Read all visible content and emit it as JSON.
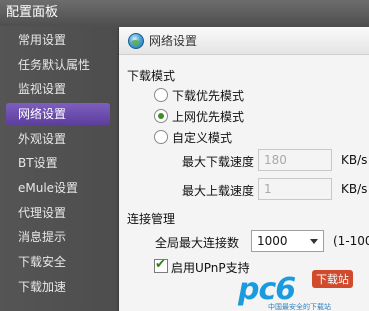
{
  "window": {
    "title": "配置面板"
  },
  "sidebar": {
    "items": [
      {
        "label": "常用设置",
        "active": false
      },
      {
        "label": "任务默认属性",
        "active": false
      },
      {
        "label": "监视设置",
        "active": false
      },
      {
        "label": "网络设置",
        "active": true
      },
      {
        "label": "外观设置",
        "active": false
      },
      {
        "label": "BT设置",
        "active": false
      },
      {
        "label": "eMule设置",
        "active": false
      },
      {
        "label": "代理设置",
        "active": false
      },
      {
        "label": "消息提示",
        "active": false
      },
      {
        "label": "下载安全",
        "active": false
      },
      {
        "label": "下载加速",
        "active": false
      }
    ]
  },
  "panel": {
    "header": {
      "title": "网络设置",
      "icon": "globe-icon"
    },
    "download_mode": {
      "title": "下载模式",
      "options": [
        {
          "label": "下载优先模式",
          "checked": false
        },
        {
          "label": "上网优先模式",
          "checked": true
        },
        {
          "label": "自定义模式",
          "checked": false
        }
      ],
      "max_download": {
        "label": "最大下载速度",
        "value": "180",
        "unit": "KB/s"
      },
      "max_upload": {
        "label": "最大上载速度",
        "value": "1",
        "unit": "KB/s"
      }
    },
    "connection": {
      "title": "连接管理",
      "max_connections": {
        "label": "全局最大连接数",
        "value": "1000",
        "hint": "(1-100"
      },
      "upnp": {
        "label": "启用UPnP支持",
        "checked": true
      }
    }
  },
  "watermark": {
    "brand": "pc6",
    "badge": "下载站",
    "sub": "中国最安全的下载站"
  }
}
